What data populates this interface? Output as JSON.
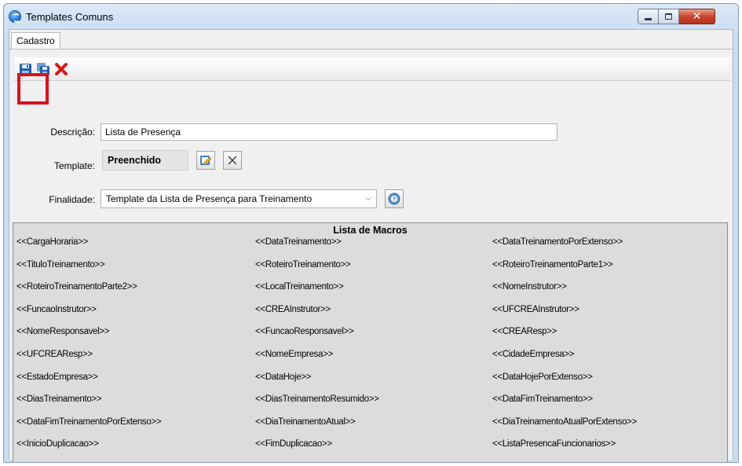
{
  "window": {
    "title": "Templates Comuns"
  },
  "tabs": [
    {
      "label": "Cadastro"
    }
  ],
  "form": {
    "descricao_label": "Descrição:",
    "descricao_value": "Lista de Presença",
    "template_label": "Template:",
    "template_value": "Preenchido",
    "finalidade_label": "Finalidade:",
    "finalidade_value": "Template da Lista de Presença para Treinamento"
  },
  "macros": {
    "title": "Lista de Macros",
    "items": [
      "<<CargaHoraria>>",
      "<<DataTreinamento>>",
      "<<DataTreinamentoPorExtenso>>",
      "<<TituloTreinamento>>",
      "<<RoteiroTreinamento>>",
      "<<RoteiroTreinamentoParte1>>",
      "<<RoteiroTreinamentoParte2>>",
      "<<LocalTreinamento>>",
      "<<NomeInstrutor>>",
      "<<FuncaoInstrutor>>",
      "<<CREAInstrutor>>",
      "<<UFCREAInstrutor>>",
      "<<NomeResponsavel>>",
      "<<FuncaoResponsavel>>",
      "<<CREAResp>>",
      "<<UFCREAResp>>",
      "<<NomeEmpresa>>",
      "<<CidadeEmpresa>>",
      "<<EstadoEmpresa>>",
      "<<DataHoje>>",
      "<<DataHojePorExtenso>>",
      "<<DiasTreinamento>>",
      "<<DiasTreinamentoResumido>>",
      "<<DataFimTreinamento>>",
      "<<DataFimTreinamentoPorExtenso>>",
      "<<DiaTreinamentoAtual>>",
      "<<DiaTreinamentoAtualPorExtenso>>",
      "<<InicioDuplicacao>>",
      "<<FimDuplicacao>>",
      "<<ListaPresencaFuncionarios>>"
    ]
  },
  "colors": {
    "highlight": "#e0101a",
    "save_icon": "#1f5fb0",
    "delete_icon": "#d81818"
  },
  "icons": {
    "app": "app-logo-icon",
    "save": "floppy-disk-icon",
    "save_as": "save-copy-icon",
    "delete": "red-x-icon",
    "edit": "edit-pencil-icon",
    "clear": "close-x-icon",
    "help": "help-question-icon",
    "dropdown": "chevron-down-icon"
  }
}
